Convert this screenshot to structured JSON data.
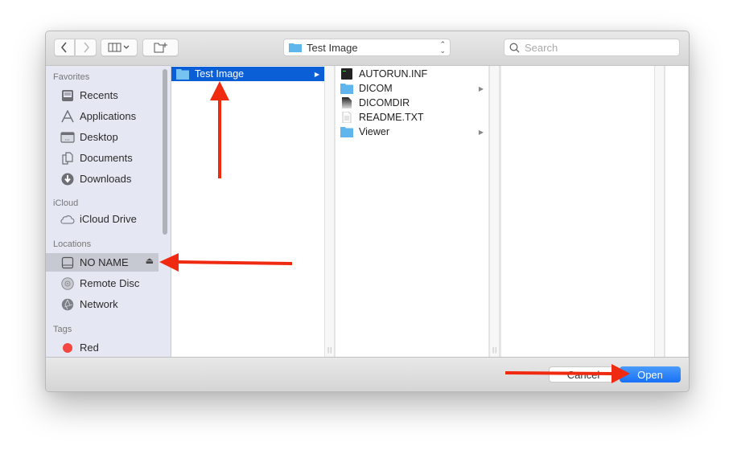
{
  "toolbar": {
    "back_icon": "chevron-left-icon",
    "forward_icon": "chevron-right-icon",
    "view_icon": "column-view-icon",
    "new_folder_icon": "new-folder-icon",
    "path_popup_value": "Test Image",
    "search_placeholder": "Search"
  },
  "sidebar": {
    "sections": [
      {
        "title": "Favorites",
        "items": [
          {
            "label": "Recents",
            "icon": "recents-icon"
          },
          {
            "label": "Applications",
            "icon": "applications-icon"
          },
          {
            "label": "Desktop",
            "icon": "desktop-icon"
          },
          {
            "label": "Documents",
            "icon": "documents-icon"
          },
          {
            "label": "Downloads",
            "icon": "downloads-icon"
          }
        ]
      },
      {
        "title": "iCloud",
        "items": [
          {
            "label": "iCloud Drive",
            "icon": "cloud-icon"
          }
        ]
      },
      {
        "title": "Locations",
        "items": [
          {
            "label": "NO NAME",
            "icon": "drive-icon",
            "selected": true,
            "eject": "⏏"
          },
          {
            "label": "Remote Disc",
            "icon": "disc-icon"
          },
          {
            "label": "Network",
            "icon": "network-icon"
          }
        ]
      },
      {
        "title": "Tags",
        "items": [
          {
            "label": "Red",
            "icon": "tag-red-icon",
            "color": "#f3473f"
          }
        ]
      }
    ]
  },
  "browser": {
    "column1": [
      {
        "name": "Test Image",
        "type": "folder",
        "selected": true,
        "has_children": true
      }
    ],
    "column2": [
      {
        "name": "AUTORUN.INF",
        "type": "exec"
      },
      {
        "name": "DICOM",
        "type": "folder",
        "has_children": true
      },
      {
        "name": "DICOMDIR",
        "type": "doc-dark"
      },
      {
        "name": "README.TXT",
        "type": "text"
      },
      {
        "name": "Viewer",
        "type": "folder",
        "has_children": true
      }
    ]
  },
  "footer": {
    "cancel_label": "Cancel",
    "open_label": "Open"
  },
  "colors": {
    "accent": "#0a5fd6",
    "open_button": "#1871f5",
    "annotation_arrow": "#f02a10",
    "folder": "#5fb6ec"
  }
}
